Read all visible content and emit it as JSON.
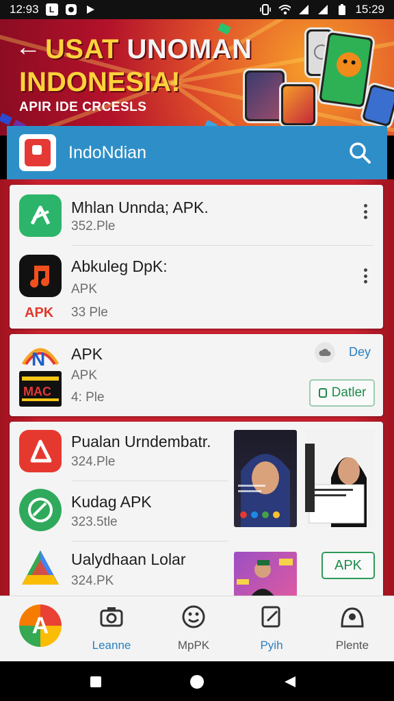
{
  "status_bar": {
    "time_left": "12:93",
    "time_right": "15:29",
    "left_icons": [
      "notification-box-icon",
      "circle-app-icon",
      "play-icon"
    ],
    "right_icons": [
      "vibrate-icon",
      "wifi-icon",
      "signal-icon",
      "signal-icon-2",
      "battery-icon"
    ]
  },
  "hero": {
    "title_part1": "USAT",
    "title_part2": "UNOMAN",
    "title_line2": "INDONESIA!",
    "subtitle": "APIR IDE CRCESLS"
  },
  "header": {
    "title": "IndoNdian",
    "accent": "#2e8fc8"
  },
  "apps": [
    {
      "name": "Mhlan Unnda; APK.",
      "meta": "352.Ple",
      "icon": "x-icon",
      "color": "#2cb56a"
    },
    {
      "name": "Abkuleg DpK:",
      "meta": "APK",
      "meta2": "33 Ple",
      "badge": "APK",
      "icon": "music-note-icon",
      "color": "#111111"
    },
    {
      "name": "APK",
      "meta": "APK",
      "meta2": "4: Ple",
      "side_label": "Dey",
      "button": "Datler",
      "icon": "n-logo-icon"
    },
    {
      "name": "Pualan Urndembatr.",
      "meta": "324.Ple",
      "icon": "a-shape-icon",
      "color": "#e5392f"
    },
    {
      "name": "Kudag APK",
      "meta": "323.5tle",
      "icon": "leaf-icon",
      "color": "#2faa5c"
    },
    {
      "name": "Ualydhaan Lolar",
      "meta": "324.PK",
      "button": "APK",
      "icon": "triangle-icon"
    }
  ],
  "bottom_nav": {
    "items": [
      {
        "label": "Leanne",
        "icon": "camera-icon",
        "active": true
      },
      {
        "label": "MpPK",
        "icon": "smiley-icon",
        "active": false
      },
      {
        "label": "Pyih",
        "icon": "edit-icon",
        "active": true
      },
      {
        "label": "Plente",
        "icon": "profile-icon",
        "active": false
      }
    ]
  },
  "system_nav": [
    "square-icon",
    "circle-icon",
    "back-triangle-icon"
  ]
}
